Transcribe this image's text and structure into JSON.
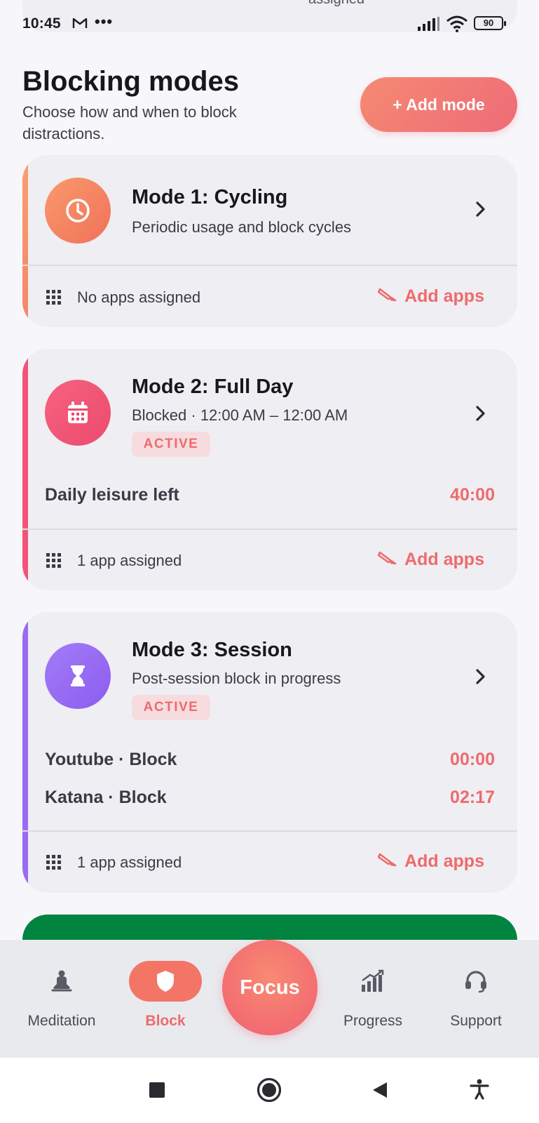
{
  "peek": {
    "text": "assigned"
  },
  "status_bar": {
    "time": "10:45",
    "dots": "•••",
    "battery": "90"
  },
  "header": {
    "title": "Blocking modes",
    "subtitle": "Choose how and when to block distractions.",
    "add_mode_label": "+ Add mode"
  },
  "modes": [
    {
      "title": "Mode 1: Cycling",
      "subtitle": "Periodic usage and block cycles",
      "icon": "clock-icon",
      "accent": "#f5866a",
      "apps_text": "No apps assigned",
      "add_apps_label": "Add apps"
    },
    {
      "title": "Mode 2: Full Day",
      "subtitle": "Blocked · 12:00 AM – 12:00 AM",
      "badge": "ACTIVE",
      "icon": "calendar-icon",
      "accent": "#f1547a",
      "rows": [
        {
          "label": "Daily leisure left",
          "value": "40:00"
        }
      ],
      "apps_text": "1 app assigned",
      "add_apps_label": "Add apps"
    },
    {
      "title": "Mode 3: Session",
      "subtitle": "Post-session block in progress",
      "badge": "ACTIVE",
      "icon": "hourglass-icon",
      "accent": "#9a6cf2",
      "rows": [
        {
          "label": "Youtube · Block",
          "value": "00:00"
        },
        {
          "label": "Katana · Block",
          "value": "02:17"
        }
      ],
      "apps_text": "1 app assigned",
      "add_apps_label": "Add apps"
    }
  ],
  "bottom_nav": {
    "items": [
      {
        "label": "Meditation",
        "icon": "meditation-icon"
      },
      {
        "label": "Block",
        "icon": "shield-icon",
        "active": true
      },
      {
        "label": "Progress",
        "icon": "chart-icon"
      },
      {
        "label": "Support",
        "icon": "headset-icon"
      }
    ],
    "focus_label": "Focus"
  },
  "colors": {
    "accent": "#ee6b6b",
    "card_bg": "#efeef3",
    "green": "#00843f"
  }
}
